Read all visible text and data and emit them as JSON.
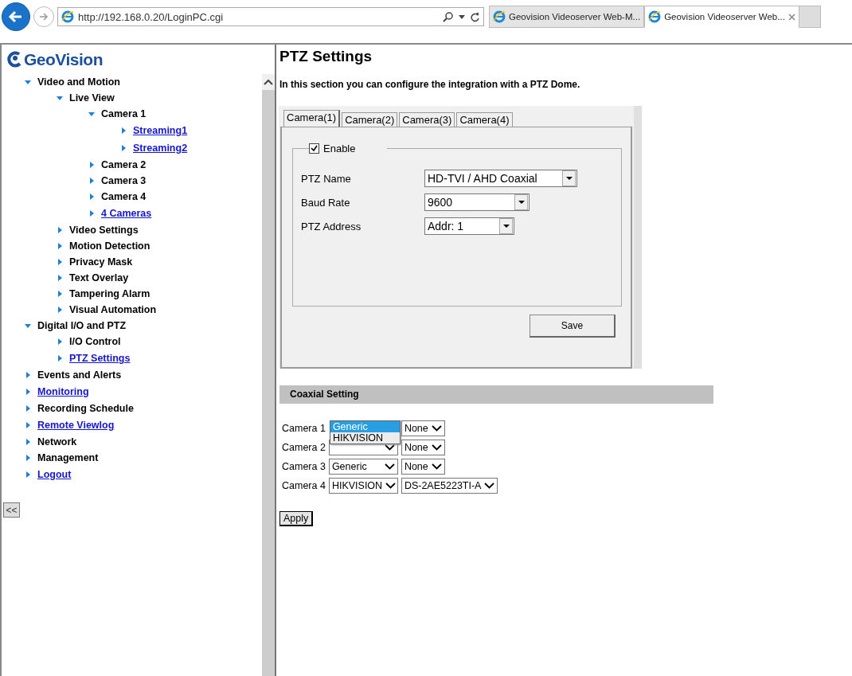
{
  "browser": {
    "address": "http://192.168.0.20/LoginPC.cgi",
    "tabs": [
      {
        "title": "Geovision Videoserver Web-M...",
        "selected": false
      },
      {
        "title": "Geovision Videoserver Web...",
        "selected": true
      }
    ]
  },
  "sidebar": {
    "logo": "GeoVision",
    "collapse_button": "<<",
    "tree": [
      {
        "label": "Video and Motion",
        "link": false,
        "expanded": true,
        "children": [
          {
            "label": "Live View",
            "link": false,
            "expanded": true,
            "children": [
              {
                "label": "Camera 1",
                "link": false,
                "expanded": true,
                "children": [
                  {
                    "label": "Streaming1",
                    "link": true,
                    "expanded": false
                  },
                  {
                    "label": "Streaming2",
                    "link": true,
                    "expanded": false
                  }
                ]
              },
              {
                "label": "Camera 2",
                "link": false,
                "expanded": false
              },
              {
                "label": "Camera 3",
                "link": false,
                "expanded": false
              },
              {
                "label": "Camera 4",
                "link": false,
                "expanded": false
              },
              {
                "label": "4 Cameras",
                "link": true,
                "expanded": false
              }
            ]
          },
          {
            "label": "Video Settings",
            "link": false,
            "expanded": false
          },
          {
            "label": "Motion Detection",
            "link": false,
            "expanded": false
          },
          {
            "label": "Privacy Mask",
            "link": false,
            "expanded": false
          },
          {
            "label": "Text Overlay",
            "link": false,
            "expanded": false
          },
          {
            "label": "Tampering Alarm",
            "link": false,
            "expanded": false
          },
          {
            "label": "Visual Automation",
            "link": false,
            "expanded": false
          }
        ]
      },
      {
        "label": "Digital I/O and PTZ",
        "link": false,
        "expanded": true,
        "children": [
          {
            "label": "I/O Control",
            "link": false,
            "expanded": false
          },
          {
            "label": "PTZ Settings",
            "link": true,
            "expanded": false
          }
        ]
      },
      {
        "label": "Events and Alerts",
        "link": false,
        "expanded": false
      },
      {
        "label": "Monitoring",
        "link": true,
        "expanded": false
      },
      {
        "label": "Recording Schedule",
        "link": false,
        "expanded": false
      },
      {
        "label": "Remote Viewlog",
        "link": true,
        "expanded": false
      },
      {
        "label": "Network",
        "link": false,
        "expanded": false
      },
      {
        "label": "Management",
        "link": false,
        "expanded": false
      },
      {
        "label": "Logout",
        "link": true,
        "expanded": false
      }
    ]
  },
  "page": {
    "title": "PTZ Settings",
    "intro": "In this section you can configure the integration with a PTZ Dome.",
    "camera_tabs": [
      {
        "label": "Camera(1)",
        "selected": true
      },
      {
        "label": "Camera(2)",
        "selected": false
      },
      {
        "label": "Camera(3)",
        "selected": false
      },
      {
        "label": "Camera(4)",
        "selected": false
      }
    ],
    "enable": {
      "label": "Enable",
      "checked": true
    },
    "fields": [
      {
        "label": "PTZ Name",
        "value": "HD-TVI / AHD Coaxial"
      },
      {
        "label": "Baud Rate",
        "value": "9600"
      },
      {
        "label": "PTZ Address",
        "value": "Addr: 1"
      }
    ],
    "save": "Save"
  },
  "coaxial": {
    "title": "Coaxial Setting",
    "rows": [
      {
        "label": "Camera 1",
        "model": "None",
        "open_options": [
          {
            "label": "Generic",
            "selected": true
          },
          {
            "label": "HIKVISION",
            "selected": false
          }
        ]
      },
      {
        "label": "Camera 2",
        "model": "None"
      },
      {
        "label": "Camera 3",
        "brand": "Generic",
        "model": "None"
      },
      {
        "label": "Camera 4",
        "brand": "HIKVISION",
        "model": "DS-2AE5223TI-A"
      }
    ],
    "apply": "Apply"
  }
}
